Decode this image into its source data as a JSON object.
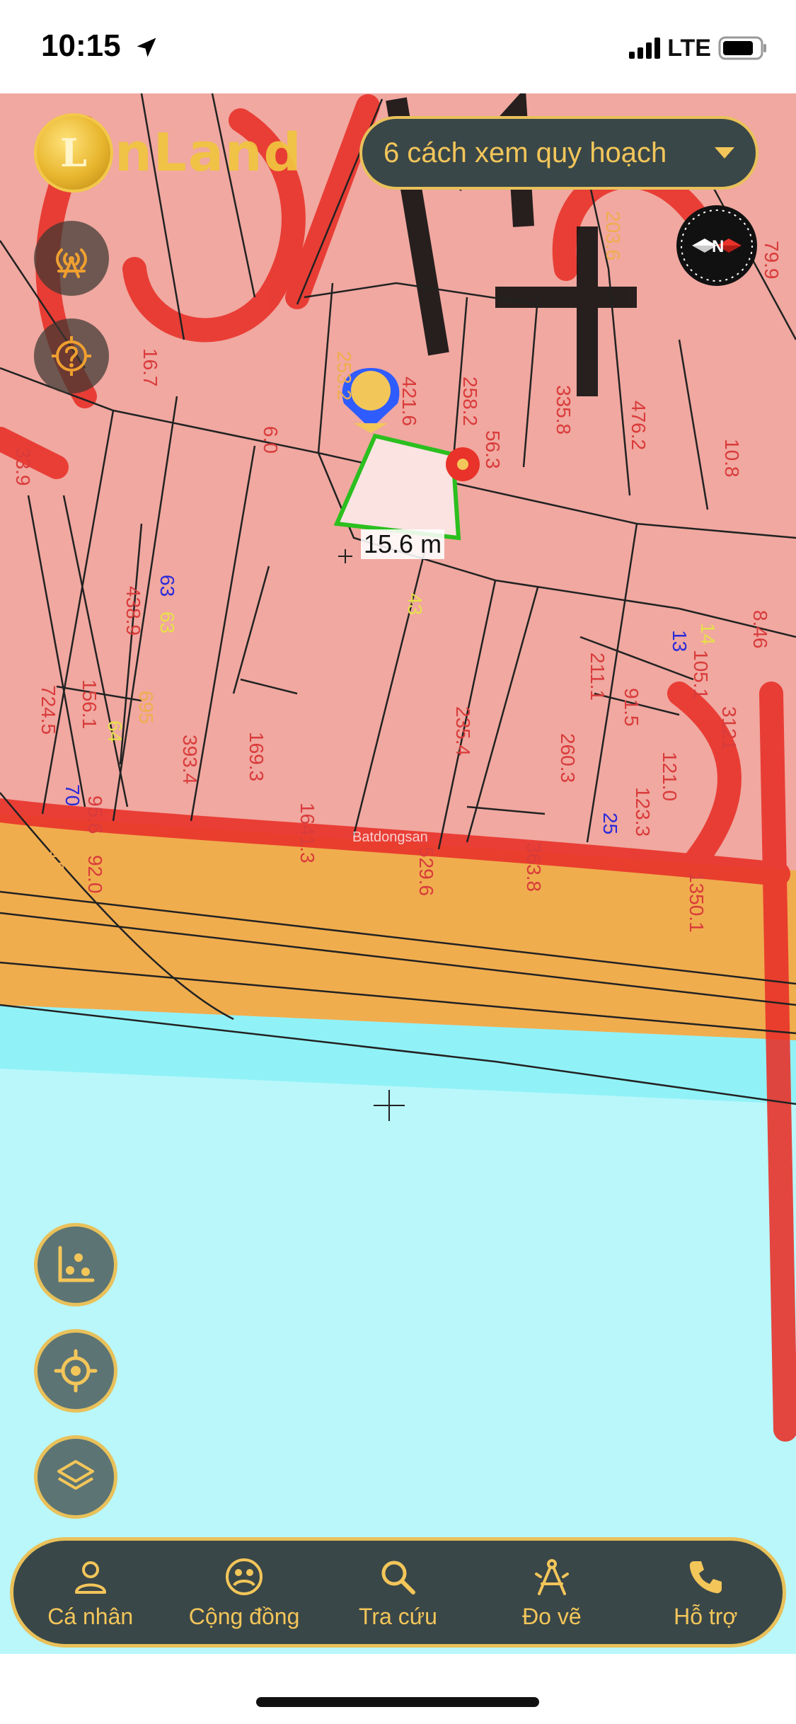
{
  "status": {
    "time": "10:15",
    "network": "LTE"
  },
  "app": {
    "logo_text": "nLand",
    "logo_coin": "L"
  },
  "header": {
    "plan_dropdown_label": "6 cách xem quy hoạch"
  },
  "map": {
    "measure_label": "15.6 m",
    "watermark": "Batdongsan",
    "parcel_labels": [
      "16.7",
      "33.9",
      "6.0",
      "253.2",
      "421.6",
      "258.2",
      "56.3",
      "335.8",
      "476.2",
      "10.8",
      "203.6",
      "79.9",
      "63",
      "63",
      "438.9",
      "724.5",
      "156.1",
      "695",
      "64",
      "70",
      "95.6",
      "92.0",
      "118.5",
      "393.4",
      "169.3",
      "1641.3",
      "529.6",
      "235.4",
      "260.3",
      "211.1",
      "91.5",
      "13",
      "105.1",
      "3121",
      "121.0",
      "123.3",
      "25",
      "363.8",
      "1350.1",
      "8.46",
      "14",
      "43"
    ]
  },
  "nav": {
    "items": [
      {
        "label": "Cá nhân",
        "icon": "person-icon"
      },
      {
        "label": "Cộng đồng",
        "icon": "community-icon"
      },
      {
        "label": "Tra cứu",
        "icon": "search-icon"
      },
      {
        "label": "Đo vẽ",
        "icon": "measure-icon"
      },
      {
        "label": "Hỗ trợ",
        "icon": "phone-icon"
      }
    ]
  },
  "compass": {
    "direction_label": "N"
  },
  "colors": {
    "accent": "#e9c15a",
    "panel": "#3a4748",
    "zone_residential": "#f0a8a0",
    "zone_road": "#f0ad4e",
    "zone_water": "#b9f7fb",
    "boundary_red": "#e8322a"
  }
}
